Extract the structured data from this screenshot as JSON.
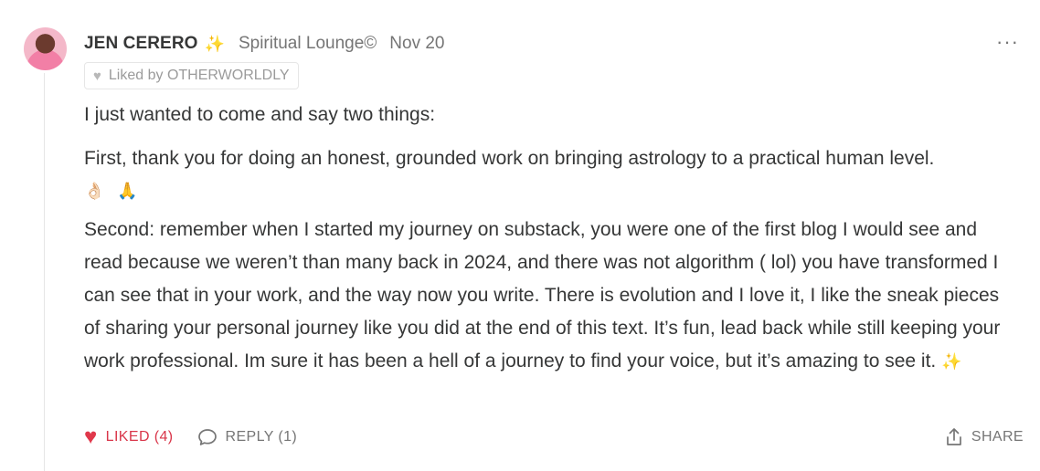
{
  "comment": {
    "author": "JEN CERERO",
    "author_badge": "✨",
    "publication": "Spiritual Lounge©",
    "date": "Nov 20",
    "more_label": "···",
    "liked_by": "Liked by OTHERWORLDLY",
    "paragraphs": [
      "I just wanted to come and say two things:",
      "First, thank you for doing an honest, grounded work on bringing astrology to a practical human level.",
      "Second: remember when I started my journey on substack, you were one of the first blog I would see and read because we weren’t than many back in 2024, and there was not algorithm ( lol) you have transformed I can see that in your work, and the way now you write. There is evolution and I love it, I like the sneak pieces of sharing your personal journey like you did at the end of this text. It’s fun, lead back while still keeping your work professional. Im sure it has been a hell of a journey to find your voice, but it’s amazing to see it."
    ],
    "emoji_line": [
      "👌🏻",
      "🙏"
    ],
    "closing_emoji": "✨",
    "actions": {
      "like_label": "LIKED (4)",
      "reply_label": "REPLY (1)",
      "share_label": "SHARE"
    },
    "colors": {
      "like": "#d9364a",
      "muted": "#757575",
      "text": "#363737"
    }
  }
}
